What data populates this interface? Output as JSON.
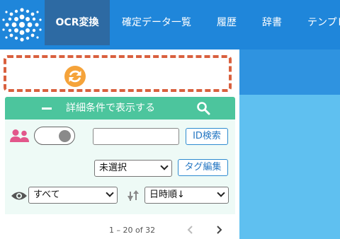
{
  "nav": {
    "items": [
      {
        "label": "OCR変換",
        "active": true
      },
      {
        "label": "確定データ一覧",
        "active": false
      },
      {
        "label": "履歴",
        "active": false
      },
      {
        "label": "辞書",
        "active": false
      },
      {
        "label": "テンプレ",
        "active": false
      }
    ]
  },
  "filter_bar": {
    "title": "詳細条件で表示する"
  },
  "filters": {
    "id_search_value": "",
    "id_search_button": "ID検索",
    "tag_select_value": "未選択",
    "tag_edit_button": "タグ編集",
    "visibility_select_value": "すべて",
    "sort_select_value": "日時順↓"
  },
  "pagination": {
    "range_text": "1 – 20 of 32"
  },
  "colors": {
    "nav_bg": "#1f86da",
    "nav_active_bg": "#2d6aa3",
    "bar_green": "#4cc59d",
    "refresh_orange": "#f5a33a",
    "dashed_border": "#d9603e",
    "right_pane": "#5fc0f0"
  }
}
